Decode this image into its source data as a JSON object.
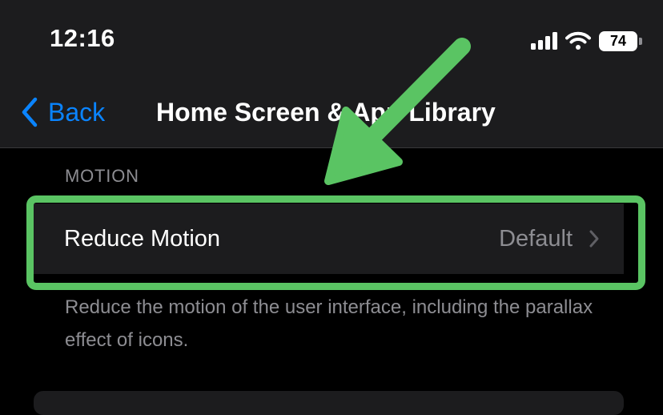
{
  "status_bar": {
    "time": "12:16",
    "battery": "74",
    "icons": [
      "cellular-signal-icon",
      "wifi-icon",
      "battery-icon"
    ]
  },
  "nav": {
    "back_label": "Back",
    "title": "Home Screen & App Library"
  },
  "motion_section": {
    "header": "MOTION",
    "row_label": "Reduce Motion",
    "row_value": "Default",
    "footer": "Reduce the motion of the user interface, including the parallax effect of icons."
  },
  "colors": {
    "background": "#000000",
    "bar_background": "#1c1c1e",
    "accent": "#0a84ff",
    "secondary_text": "#8d8d92",
    "highlight": "#5ac463"
  }
}
